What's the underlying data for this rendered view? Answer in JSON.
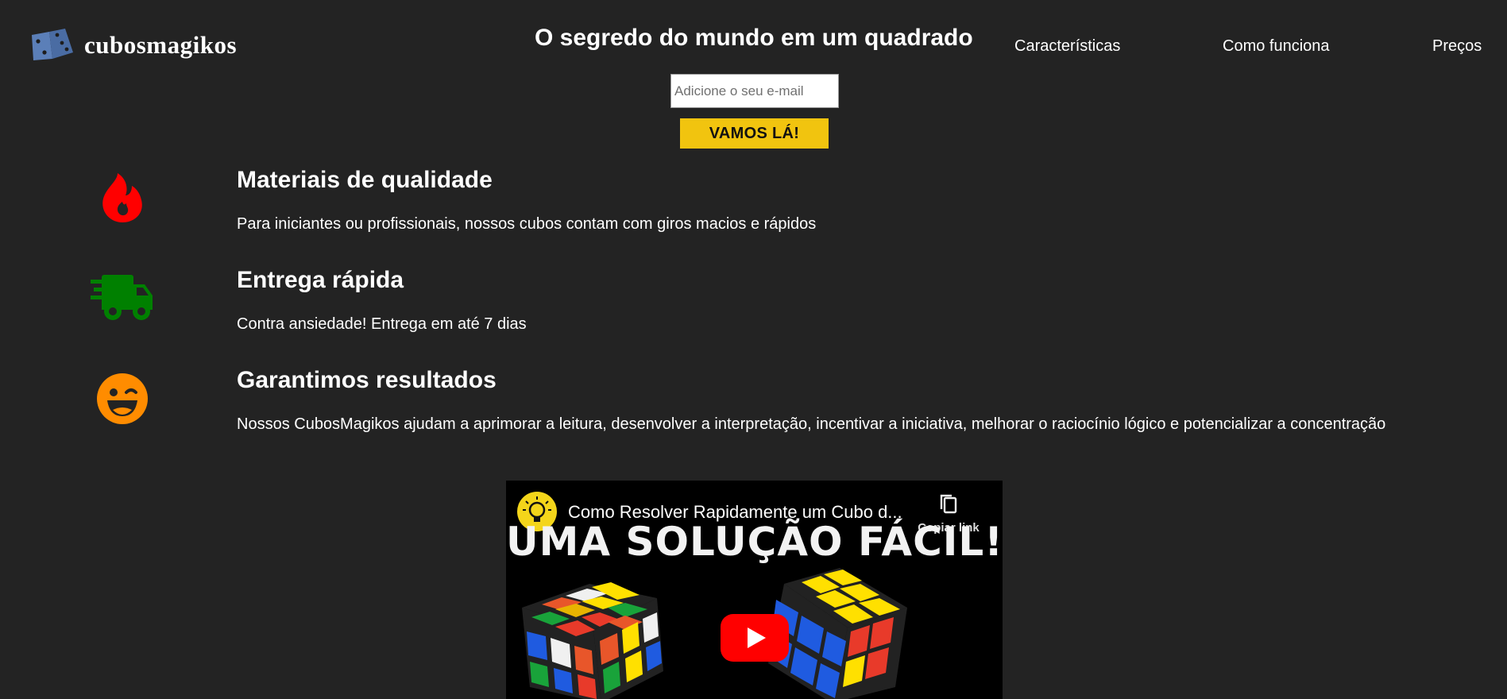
{
  "header": {
    "brand": "cubosmagikos",
    "headline": "O segredo do mundo em um quadrado",
    "nav": [
      {
        "label": "Características"
      },
      {
        "label": "Como funciona"
      },
      {
        "label": "Preços"
      }
    ]
  },
  "form": {
    "email_placeholder": "Adicione o seu e-mail",
    "submit_label": "VAMOS LÁ!"
  },
  "features": [
    {
      "icon": "fire-icon",
      "title": "Materiais de qualidade",
      "text": "Para iniciantes ou profissionais, nossos cubos contam com giros macios e rápidos"
    },
    {
      "icon": "truck-icon",
      "title": "Entrega rápida",
      "text": "Contra ansiedade! Entrega em até 7 dias"
    },
    {
      "icon": "wink-face-icon",
      "title": "Garantimos resultados",
      "text": "Nossos CubosMagikos ajudam a aprimorar a leitura, desenvolver a interpretação, incentivar a iniciativa, melhorar o raciocínio lógico e potencializar a concentração"
    }
  ],
  "video": {
    "title": "Como Resolver Rapidamente um Cubo d...",
    "copy_link_label": "Copiar link",
    "banner_text": "UMA SOLUÇÃO FÁCIL!"
  },
  "colors": {
    "background": "#232323",
    "cta": "#f1c40f",
    "fire": "#ff0000",
    "truck": "#008000",
    "wink": "#ff8c00",
    "logo_dice": "#5b7fb8"
  }
}
